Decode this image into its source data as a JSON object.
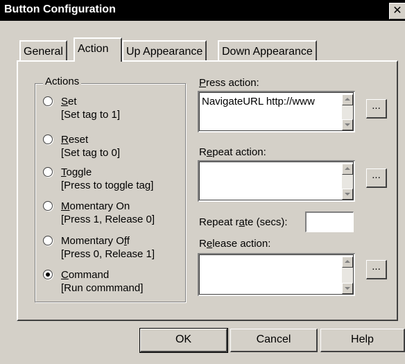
{
  "window": {
    "title": "Button Configuration",
    "close_glyph": "✕"
  },
  "tabs": [
    {
      "label": "General",
      "active": false
    },
    {
      "label": "Action",
      "active": true
    },
    {
      "label": "Up Appearance",
      "active": false
    },
    {
      "label": "Down Appearance",
      "active": false
    }
  ],
  "actions_group": {
    "legend": "Actions",
    "options": [
      {
        "label": "Set",
        "mnemonic": "S",
        "rest": "et",
        "description": "[Set tag to 1]",
        "selected": false
      },
      {
        "label": "Reset",
        "mnemonic": "R",
        "rest": "eset",
        "description": "[Set tag to 0]",
        "selected": false
      },
      {
        "label": "Toggle",
        "mnemonic": "T",
        "rest": "oggle",
        "description": "[Press to toggle tag]",
        "selected": false
      },
      {
        "label": "Momentary On",
        "mnemonic": "M",
        "rest": "omentary On",
        "description": "[Press 1, Release 0]",
        "selected": false
      },
      {
        "label": "Momentary Off",
        "pre": "Momentary O",
        "mnemonic": "f",
        "post": "f",
        "description": "[Press 0, Release 1]",
        "selected": false
      },
      {
        "label": "Command",
        "mnemonic": "C",
        "rest": "ommand",
        "description": "[Run commmand]",
        "selected": true
      }
    ]
  },
  "press_action": {
    "mnemonic": "P",
    "rest": "ress action:",
    "value": "NavigateURL http://www"
  },
  "repeat_action": {
    "pre": "R",
    "mnemonic": "e",
    "post": "peat action:",
    "value": ""
  },
  "repeat_rate": {
    "pre": "Repeat r",
    "mnemonic": "a",
    "post": "te (secs):",
    "value": ""
  },
  "release_action": {
    "pre": "R",
    "mnemonic": "e",
    "post": "lease action:",
    "value": ""
  },
  "ellipsis_label": "...",
  "buttons": {
    "ok": "OK",
    "cancel": "Cancel",
    "help": "Help"
  }
}
